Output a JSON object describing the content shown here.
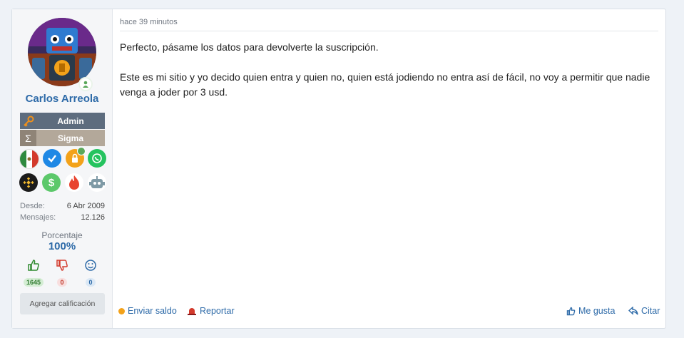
{
  "user": {
    "name": "Carlos Arreola",
    "ranks": [
      {
        "label": "Admin",
        "icon": "key-icon",
        "bg": "#5d6c7e"
      },
      {
        "label": "Sigma",
        "icon": "sigma-icon",
        "bg": "#b3a89a"
      }
    ],
    "stats": [
      {
        "key": "Desde:",
        "value": "6 Abr 2009"
      },
      {
        "key": "Mensajes:",
        "value": "12.126"
      }
    ],
    "percent_label": "Porcentaje",
    "percent_value": "100%",
    "ratings": [
      {
        "icon": "thumbs-up-icon",
        "count": "1645",
        "color": "#2f8a2f"
      },
      {
        "icon": "thumbs-down-icon",
        "count": "0",
        "color": "#d33a2c"
      },
      {
        "icon": "smiley-icon",
        "count": "0",
        "color": "#2d6aa8"
      }
    ],
    "add_rating_label": "Agregar calificación"
  },
  "post": {
    "time": "hace 39 minutos",
    "paragraphs": [
      "Perfecto, pásame los datos para devolverte la suscripción.",
      "Este es mi sitio y yo decido quien entra y quien no, quien está jodiendo no entra así de fácil, no voy a permitir que nadie venga a joder por 3 usd."
    ]
  },
  "actions": {
    "send_balance": "Enviar saldo",
    "report": "Reportar",
    "like": "Me gusta",
    "quote": "Citar"
  }
}
